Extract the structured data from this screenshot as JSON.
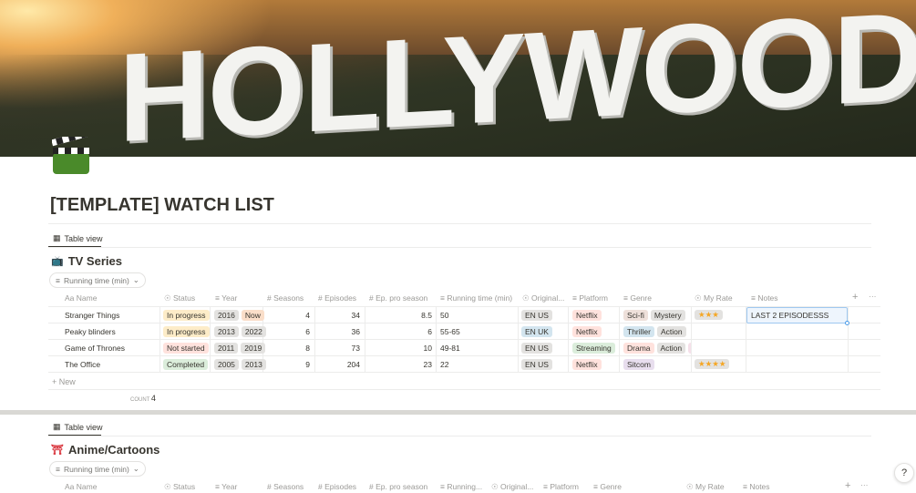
{
  "banner": {
    "text": "HOLLYWOOD"
  },
  "page": {
    "title": "[TEMPLATE] WATCH LIST"
  },
  "colors": {
    "gray": "#e3e2e0",
    "brown": "#eee0da",
    "orange": "#fadec9",
    "yellow": "#fdecc8",
    "green": "#dbeddb",
    "blue": "#d3e5ef",
    "purple": "#e8deee",
    "pink": "#f5e0e9",
    "red": "#ffe2dd",
    "star": "#f5a623"
  },
  "tv": {
    "tab": "Table view",
    "title": "TV Series",
    "sort_pill": "Running time (min)",
    "headers": {
      "name": "Name",
      "status": "Status",
      "year": "Year",
      "seasons": "Seasons",
      "episodes": "Episodes",
      "ep_season": "Ep. pro season",
      "running": "Running time (min)",
      "original": "Original...",
      "platform": "Platform",
      "genre": "Genre",
      "rate": "My Rate",
      "notes": "Notes"
    },
    "rows": [
      {
        "name": "Stranger Things",
        "status": "In progress",
        "year1": "2016",
        "year2": "Now",
        "seasons": "4",
        "episodes": "34",
        "ep_season": "8.5",
        "running": "50",
        "original": "EN US",
        "platform": "Netflix",
        "genre1": "Sci-fi",
        "genre2": "Mystery",
        "genre3": "",
        "rate": "★★★",
        "notes": "LAST 2 EPISODESSS"
      },
      {
        "name": "Peaky blinders",
        "status": "In progress",
        "year1": "2013",
        "year2": "2022",
        "seasons": "6",
        "episodes": "36",
        "ep_season": "6",
        "running": "55-65",
        "original": "EN UK",
        "platform": "Netflix",
        "genre1": "Thriller",
        "genre2": "Action",
        "genre3": "",
        "rate": "",
        "notes": ""
      },
      {
        "name": "Game of Thrones",
        "status": "Not started",
        "year1": "2011",
        "year2": "2019",
        "seasons": "8",
        "episodes": "73",
        "ep_season": "10",
        "running": "49-81",
        "original": "EN US",
        "platform": "Streaming",
        "genre1": "Drama",
        "genre2": "Action",
        "genre3": "F",
        "rate": "",
        "notes": ""
      },
      {
        "name": "The Office",
        "status": "Completed",
        "year1": "2005",
        "year2": "2013",
        "seasons": "9",
        "episodes": "204",
        "ep_season": "23",
        "running": "22",
        "original": "EN US",
        "platform": "Netflix",
        "genre1": "Sitcom",
        "genre2": "",
        "genre3": "",
        "rate": "★★★★",
        "notes": ""
      }
    ],
    "new_label": "New",
    "count_label": "COUNT",
    "count_value": "4"
  },
  "anime": {
    "tab": "Table view",
    "title": "Anime/Cartoons",
    "sort_pill": "Running time (min)",
    "headers": {
      "name": "Name",
      "status": "Status",
      "year": "Year",
      "seasons": "Seasons",
      "episodes": "Episodes",
      "ep_season": "Ep. pro season",
      "running": "Running...",
      "original": "Original...",
      "platform": "Platform",
      "genre": "Genre",
      "rate": "My Rate",
      "notes": "Notes"
    }
  },
  "help": "?"
}
